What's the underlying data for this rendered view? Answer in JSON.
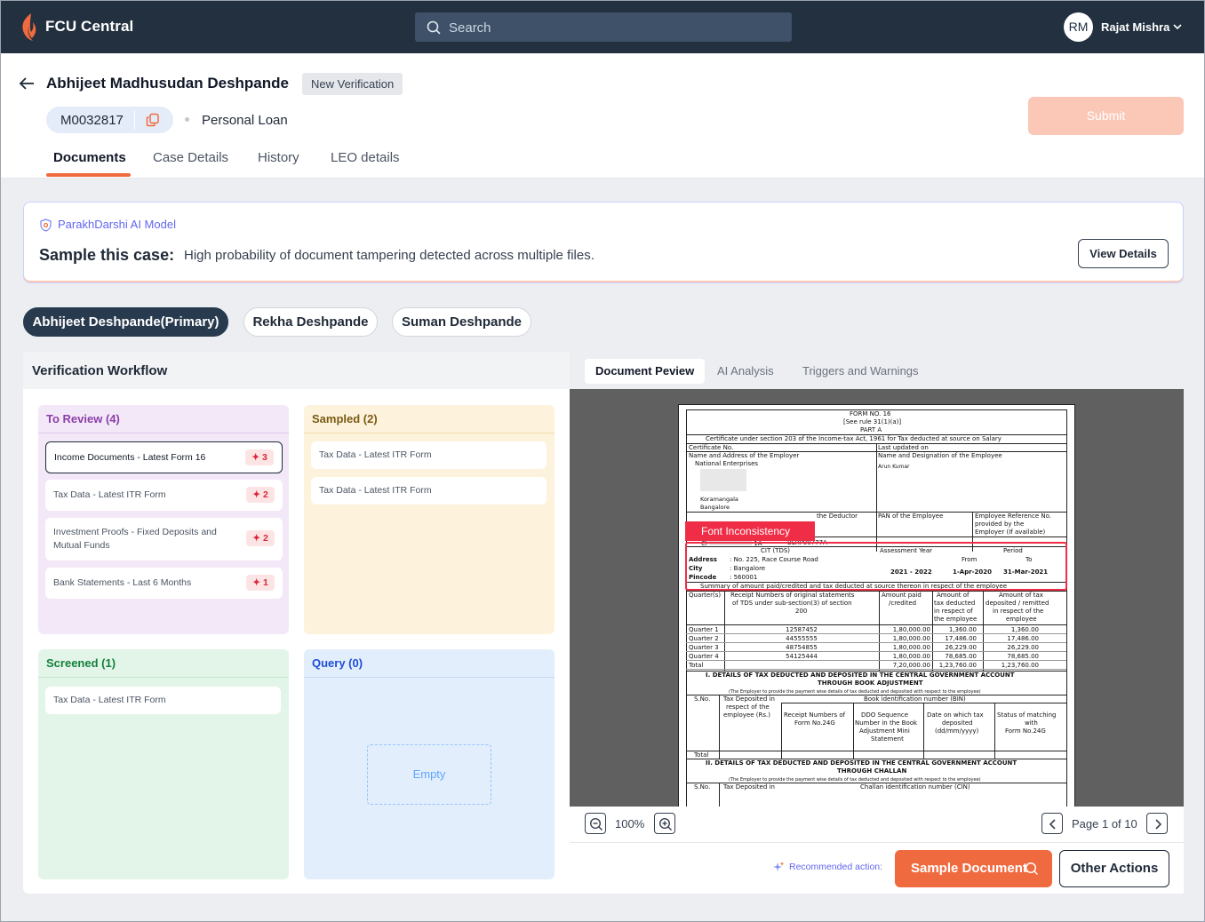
{
  "app": {
    "title": "FCU Central"
  },
  "search": {
    "placeholder": "Search"
  },
  "user": {
    "initials": "RM",
    "name": "Rajat Mishra"
  },
  "case": {
    "name": "Abhijeet Madhusudan Deshpande",
    "status_badge": "New Verification",
    "id": "M0032817",
    "product": "Personal Loan",
    "submit_label": "Submit"
  },
  "tabs": [
    "Documents",
    "Case Details",
    "History",
    "LEO details"
  ],
  "ai_banner": {
    "model": "ParakhDarshi AI Model",
    "title": "Sample this case:",
    "text": "High probability of document tampering detected across multiple files.",
    "button": "View Details"
  },
  "applicants": [
    "Abhijeet Deshpande(Primary)",
    "Rekha Deshpande",
    "Suman Deshpande"
  ],
  "workflow": {
    "title": "Verification Workflow",
    "to_review": {
      "title": "To Review (4)",
      "cards": [
        {
          "label": "Income Documents - Latest Form 16",
          "count": "3"
        },
        {
          "label": "Tax Data - Latest ITR Form",
          "count": "2"
        },
        {
          "label": "Investment Proofs - Fixed Deposits and",
          "label2": "Mutual Funds",
          "count": "2"
        },
        {
          "label": "Bank Statements - Last 6 Months",
          "count": "1"
        }
      ]
    },
    "sampled": {
      "title": "Sampled (2)",
      "cards": [
        "Tax Data - Latest ITR Form",
        "Tax Data - Latest ITR Form"
      ]
    },
    "screened": {
      "title": "Screened (1)",
      "cards": [
        "Tax Data - Latest ITR Form"
      ]
    },
    "query": {
      "title": "Query (0)",
      "empty": "Empty"
    }
  },
  "preview": {
    "tabs": [
      "Document Peview",
      "AI Analysis",
      "Triggers and Warnings"
    ],
    "flag": "Font Inconsistency",
    "zoom": "100%",
    "page": "Page 1 of 10",
    "recommended_label": "Recommended action:",
    "sample_button": "Sample Document",
    "other_button": "Other Actions"
  },
  "form16": {
    "form_no": "FORM NO. 16",
    "rule": "[See rule 31(1)(a)]",
    "part": "PART A",
    "certificate": "Certificate under section 203 of the Income-tax Act, 1961 for Tax deducted at source on Salary",
    "cert_no": "Certificate No.",
    "last_updated": "Last updated on",
    "employer_hdr": "Name and Address of the Employer",
    "employer_name": "National Enterprises",
    "employee_hdr": "Name and Designation of the Employee",
    "employee_name": "Arun Kumar",
    "addr1": "Koramangala",
    "addr2": "Bangalore",
    "pan_employee": "PAN of the Employee",
    "emp_ref": "Employee Reference No.",
    "emp_ref2": "provided by the",
    "emp_ref3": "Employer (If available)",
    "deductor_partial": "the Deductor",
    "tan_partial": "1A",
    "pan_code": "BLRP00777A",
    "cit": "CIT (TDS)",
    "address_lbl": "Address",
    "address_val": ": No. 225, Race Course Road",
    "city_lbl": "City",
    "city_val": ": Bangalore",
    "pincode_lbl": "Pincode",
    "pincode_val": ": 560001",
    "assessment_year": "Assessment Year",
    "ay_val": "2021 - 2022",
    "period": "Period",
    "from": "From",
    "to": "To",
    "from_val": "1-Apr-2020",
    "to_val": "31-Mar-2021",
    "summary": "Summary of amount paid/credited and tax deducted at source thereon in respect of the employee",
    "col_quarter": "Quarter(s)",
    "col_receipt": "Receipt Numbers of original statements",
    "col_receipt2": "of TDS under sub-section(3) of section",
    "col_receipt3": "200",
    "col_amount": "Amount paid",
    "col_amount2": "/credited",
    "col_taxded": "Amount of",
    "col_taxded2": "tax deducted",
    "col_taxded3": "in respect of",
    "col_taxded4": "the employee",
    "col_deposited": "Amount of tax",
    "col_deposited2": "deposited / remitted",
    "col_deposited3": "in respect of the",
    "col_deposited4": "employee",
    "rows": [
      {
        "q": "Quarter 1",
        "r": "12587452",
        "a": "1,80,000.00",
        "t": "1,360.00",
        "d": "1,360.00"
      },
      {
        "q": "Quarter 2",
        "r": "44555555",
        "a": "1,80,000.00",
        "t": "17,486.00",
        "d": "17,486.00"
      },
      {
        "q": "Quarter 3",
        "r": "48754855",
        "a": "1,80,000.00",
        "t": "26,229.00",
        "d": "26,229.00"
      },
      {
        "q": "Quarter 4",
        "r": "54125444",
        "a": "1,80,000.00",
        "t": "78,685.00",
        "d": "78,685.00"
      },
      {
        "q": "Total",
        "r": "",
        "a": "7,20,000.00",
        "t": "1,23,760.00",
        "d": "1,23,760.00"
      }
    ],
    "sec1": "I. DETAILS OF TAX DEDUCTED AND DEPOSITED IN THE CENTRAL GOVERNMENT ACCOUNT",
    "sec1b": "THROUGH BOOK ADJUSTMENT",
    "note": "(The Employer to provide the payment wise details of tax deducted and deposited with respect to the employee)",
    "sno": "S.No.",
    "tax_dep": "Tax Deposited in",
    "tax_dep2": "respect of the",
    "tax_dep3": "employee (Rs.)",
    "bin": "Book identification number (BIN)",
    "bin_c1": "Receipt Numbers of",
    "bin_c1b": "Form No.24G",
    "bin_c2": "DDO Sequence",
    "bin_c2b": "Number in the Book",
    "bin_c2c": "Adjustment Mini",
    "bin_c2d": "Statement",
    "bin_c3": "Date on which tax",
    "bin_c3b": "deposited",
    "bin_c3c": "(dd/mm/yyyy)",
    "bin_c4": "Status of matching",
    "bin_c4b": "with",
    "bin_c4c": "Form No.24G",
    "total": "Total",
    "sec2": "II. DETAILS OF TAX DEDUCTED AND DEPOSITED IN THE CENTRAL GOVERNMENT ACCOUNT",
    "sec2b": "THROUGH CHALLAN",
    "cin": "Challan identification number (CIN)"
  },
  "colors": {
    "accent": "#f06a3f",
    "nav": "#22303f",
    "danger": "#ef2d46"
  }
}
